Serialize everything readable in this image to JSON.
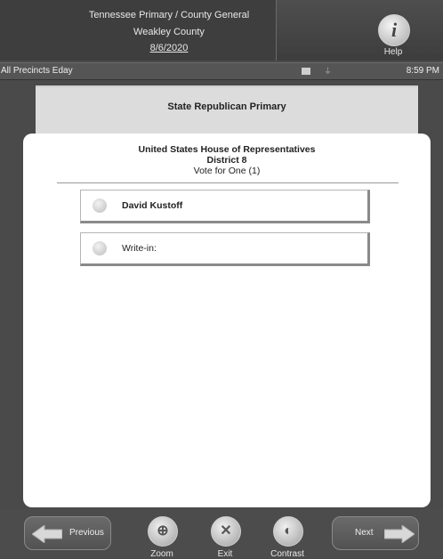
{
  "header": {
    "line1": "Tennessee Primary / County General",
    "line2": "Weakley County",
    "date": "8/6/2020",
    "help_label": "Help",
    "help_glyph": "i"
  },
  "status": {
    "location": "All Precincts Eday",
    "time": "8:59 PM"
  },
  "contest": {
    "title": "State Republican Primary",
    "office_line1": "United States House of Representatives",
    "office_line2": "District 8",
    "instruction": "Vote for One (1)"
  },
  "candidates": [
    {
      "name": "David Kustoff"
    },
    {
      "name": "Write-in:"
    }
  ],
  "nav": {
    "previous": "Previous",
    "next": "Next",
    "zoom": "Zoom",
    "exit": "Exit",
    "contrast": "Contrast"
  },
  "icons": {
    "help": "info-icon",
    "zoom": "magnifier-icon",
    "exit": "x-icon",
    "contrast": "contrast-icon"
  }
}
